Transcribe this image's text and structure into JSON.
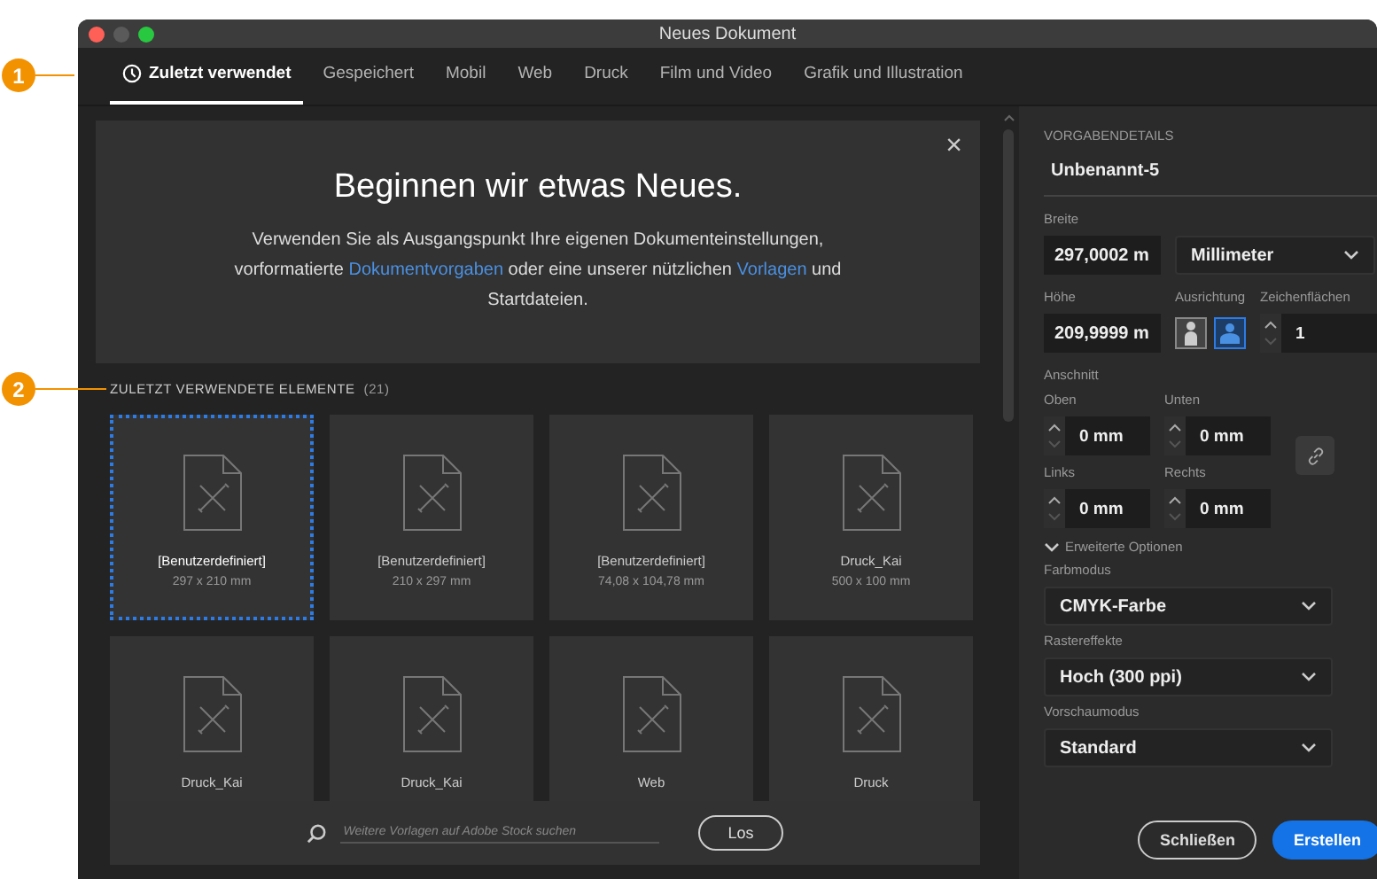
{
  "window": {
    "title": "Neues Dokument"
  },
  "callouts": [
    {
      "number": "1"
    },
    {
      "number": "2"
    }
  ],
  "tabs": [
    {
      "label": "Zuletzt verwendet",
      "selected": true
    },
    {
      "label": "Gespeichert",
      "selected": false
    },
    {
      "label": "Mobil",
      "selected": false
    },
    {
      "label": "Web",
      "selected": false
    },
    {
      "label": "Druck",
      "selected": false
    },
    {
      "label": "Film und Video",
      "selected": false
    },
    {
      "label": "Grafik und Illustration",
      "selected": false
    }
  ],
  "banner": {
    "title": "Beginnen wir etwas Neues.",
    "text": "Verwenden Sie als Ausgangspunkt Ihre eigenen Dokumenteinstellungen, vorformatierte",
    "link1": "Dokumentvorgaben",
    "middle": "oder eine unserer nützlichen",
    "link2": "Vorlagen",
    "end": "und Startdateien.",
    "close": "×"
  },
  "recent": {
    "heading": "ZULETZT VERWENDETE ELEMENTE",
    "count": "(21)",
    "items": [
      {
        "name": "[Benutzerdefiniert]",
        "size": "297 x 210 mm",
        "selected": true
      },
      {
        "name": "[Benutzerdefiniert]",
        "size": "210 x 297 mm",
        "selected": false
      },
      {
        "name": "[Benutzerdefiniert]",
        "size": "74,08 x 104,78 mm",
        "selected": false
      },
      {
        "name": "Druck_Kai",
        "size": "500 x 100 mm",
        "selected": false
      },
      {
        "name": "Druck_Kai",
        "selected": false
      },
      {
        "name": "Druck_Kai",
        "selected": false
      },
      {
        "name": "Web",
        "selected": false
      },
      {
        "name": "Druck",
        "selected": false
      }
    ]
  },
  "stock_search": {
    "placeholder": "Weitere Vorlagen auf Adobe Stock suchen",
    "button": "Los"
  },
  "preset": {
    "heading": "VORGABENDETAILS",
    "name": "Unbenannt-5",
    "width_label": "Breite",
    "width": "297,0002 m",
    "unit": "Millimeter",
    "height_label": "Höhe",
    "height": "209,9999 m",
    "orientation_label": "Ausrichtung",
    "orientation": [
      {
        "kind": "portrait",
        "selected": false
      },
      {
        "kind": "landscape",
        "selected": true
      }
    ],
    "artboards_label": "Zeichenflächen",
    "artboards": "1",
    "bleed_label": "Anschnitt",
    "bleed": [
      {
        "label": "Oben",
        "value": "0 mm"
      },
      {
        "label": "Unten",
        "value": "0 mm"
      },
      {
        "label": "Links",
        "value": "0 mm"
      },
      {
        "label": "Rechts",
        "value": "0 mm"
      }
    ],
    "advanced": "Erweiterte Optionen",
    "advanced_expanded": true,
    "selects": [
      {
        "label": "Farbmodus",
        "value": "CMYK-Farbe"
      },
      {
        "label": "Rastereffekte",
        "value": "Hoch (300 ppi)"
      },
      {
        "label": "Vorschaumodus",
        "value": "Standard"
      }
    ]
  },
  "buttons": [
    {
      "label": "Schließen",
      "kind": "secondary"
    },
    {
      "label": "Erstellen",
      "kind": "primary"
    }
  ]
}
